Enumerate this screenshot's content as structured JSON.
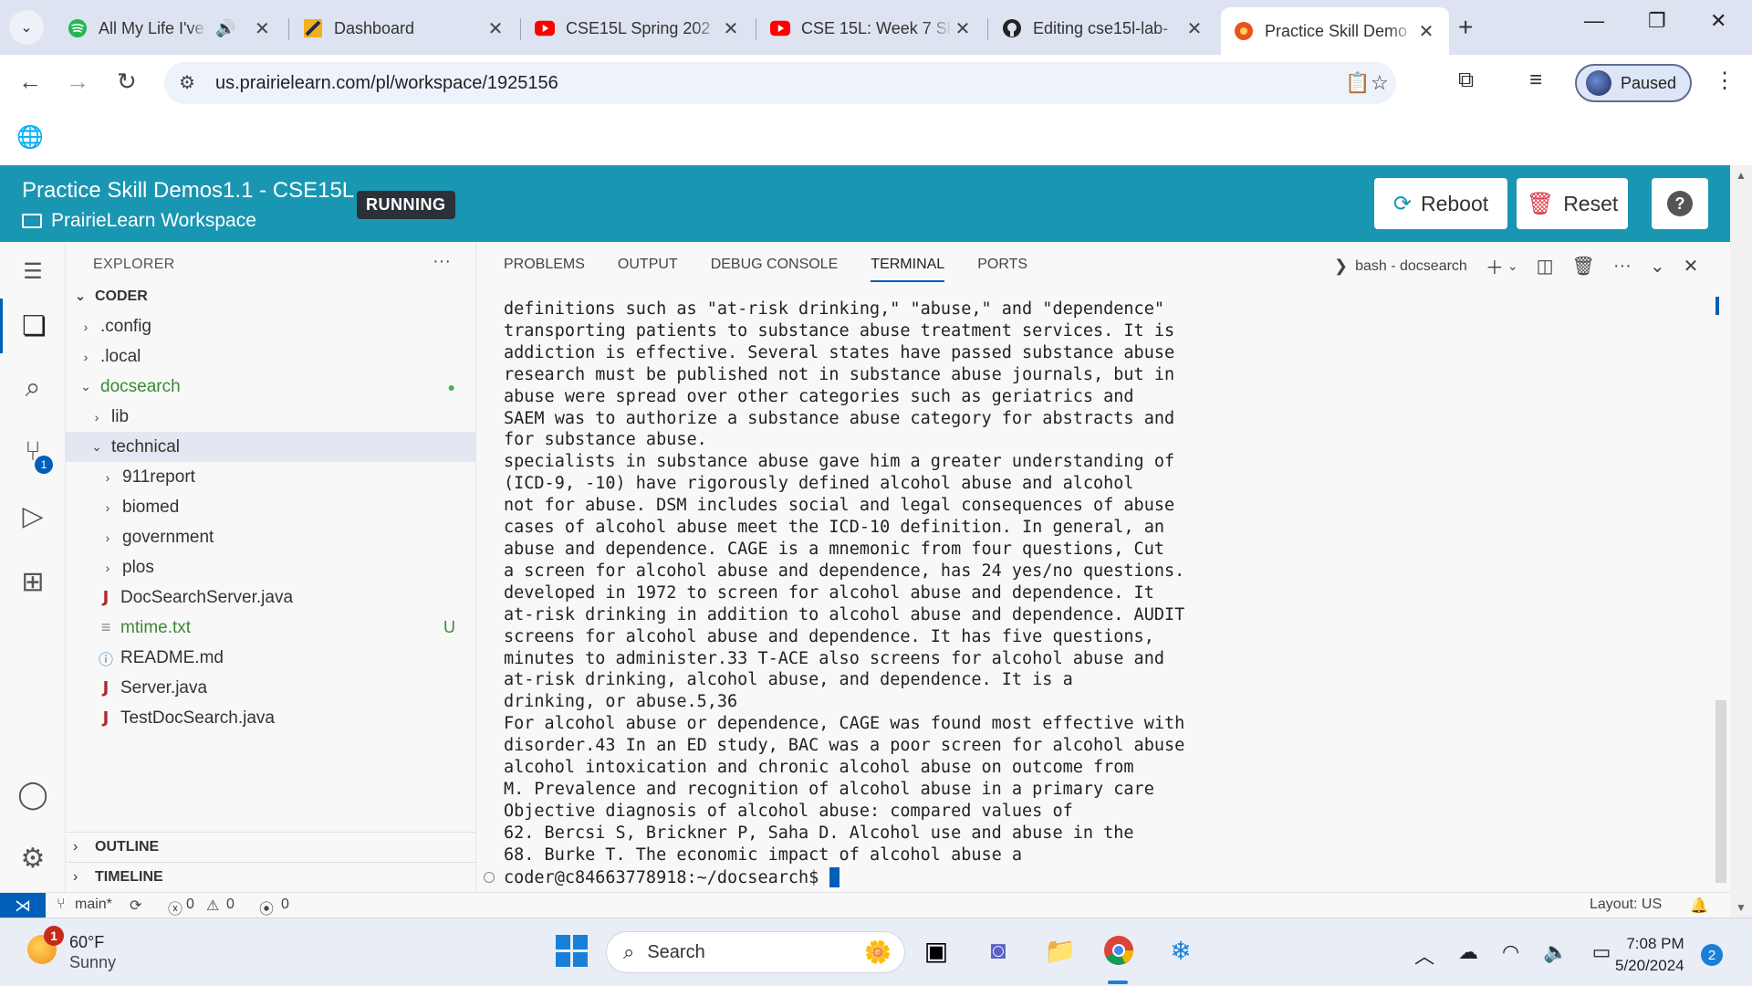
{
  "browser": {
    "tabs": [
      {
        "title": "All My Life I've",
        "icon": "spotify-icon",
        "audio": true
      },
      {
        "title": "Dashboard",
        "icon": "canvas-icon"
      },
      {
        "title": "CSE15L Spring 202",
        "icon": "youtube-icon"
      },
      {
        "title": "CSE 15L: Week 7 Sl",
        "icon": "youtube-icon"
      },
      {
        "title": "Editing cse15l-lab-",
        "icon": "github-icon"
      },
      {
        "title": "Practice Skill Demo",
        "icon": "prairielearn-icon",
        "active": true
      }
    ],
    "url": "us.prairielearn.com/pl/workspace/1925156",
    "profile_label": "Paused"
  },
  "workspace": {
    "title": "Practice Skill Demos1.1 - CSE15L",
    "subtitle": "PrairieLearn Workspace",
    "status": "RUNNING",
    "reboot_label": "Reboot",
    "reset_label": "Reset",
    "help_label": "?"
  },
  "explorer": {
    "header": "EXPLORER",
    "more": "···",
    "root": "CODER",
    "items": [
      {
        "label": ".config",
        "kind": "folder",
        "depth": 1,
        "open": false
      },
      {
        "label": ".local",
        "kind": "folder",
        "depth": 1,
        "open": false
      },
      {
        "label": "docsearch",
        "kind": "folder",
        "depth": 1,
        "open": true,
        "modified_dot": true
      },
      {
        "label": "lib",
        "kind": "folder",
        "depth": 2,
        "open": false
      },
      {
        "label": "technical",
        "kind": "folder",
        "depth": 2,
        "open": true,
        "selected": true
      },
      {
        "label": "911report",
        "kind": "folder",
        "depth": 3,
        "open": false
      },
      {
        "label": "biomed",
        "kind": "folder",
        "depth": 3,
        "open": false
      },
      {
        "label": "government",
        "kind": "folder",
        "depth": 3,
        "open": false
      },
      {
        "label": "plos",
        "kind": "folder",
        "depth": 3,
        "open": false
      },
      {
        "label": "DocSearchServer.java",
        "kind": "java",
        "depth": 2
      },
      {
        "label": "mtime.txt",
        "kind": "txt",
        "depth": 2,
        "status": "U"
      },
      {
        "label": "README.md",
        "kind": "info",
        "depth": 2
      },
      {
        "label": "Server.java",
        "kind": "java",
        "depth": 2
      },
      {
        "label": "TestDocSearch.java",
        "kind": "java",
        "depth": 2
      }
    ],
    "outline_label": "OUTLINE",
    "timeline_label": "TIMELINE"
  },
  "panel": {
    "tabs": [
      "PROBLEMS",
      "OUTPUT",
      "DEBUG CONSOLE",
      "TERMINAL",
      "PORTS"
    ],
    "active_tab": "TERMINAL",
    "terminal_name": "bash - docsearch",
    "terminal_lines": [
      "definitions such as \"at-risk drinking,\" \"abuse,\" and \"dependence\"",
      "transporting patients to substance abuse treatment services. It is",
      "addiction is effective. Several states have passed substance abuse",
      "research must be published not in substance abuse journals, but in",
      "abuse were spread over other categories such as geriatrics and",
      "SAEM was to authorize a substance abuse category for abstracts and",
      "for substance abuse.",
      "specialists in substance abuse gave him a greater understanding of",
      "(ICD-9, -10) have rigorously defined alcohol abuse and alcohol",
      "not for abuse. DSM includes social and legal consequences of abuse",
      "cases of alcohol abuse meet the ICD-10 definition. In general, an",
      "abuse and dependence. CAGE is a mnemonic from four questions, Cut",
      "a screen for alcohol abuse and dependence, has 24 yes/no questions.",
      "developed in 1972 to screen for alcohol abuse and dependence. It",
      "at-risk drinking in addition to alcohol abuse and dependence. AUDIT",
      "screens for alcohol abuse and dependence. It has five questions,",
      "minutes to administer.33 T-ACE also screens for alcohol abuse and",
      "at-risk drinking, alcohol abuse, and dependence. It is a",
      "drinking, or abuse.5,36",
      "For alcohol abuse or dependence, CAGE was found most effective with",
      "disorder.43 In an ED study, BAC was a poor screen for alcohol abuse",
      "alcohol intoxication and chronic alcohol abuse on outcome from",
      "M. Prevalence and recognition of alcohol abuse in a primary care",
      "Objective diagnosis of alcohol abuse: compared values of",
      "62. Bercsi S, Brickner P, Saha D. Alcohol use and abuse in the",
      "68. Burke T. The economic impact of alcohol abuse a"
    ],
    "prompt": "coder@c84663778918:~/docsearch$"
  },
  "activity": {
    "source_control_badge": "1"
  },
  "statusbar": {
    "branch": "main*",
    "errors": "0",
    "warnings": "0",
    "ports": "0",
    "layout": "Layout: US"
  },
  "taskbar": {
    "temp": "60°F",
    "condition": "Sunny",
    "weather_badge": "1",
    "search_placeholder": "Search",
    "time": "7:08 PM",
    "date": "5/20/2024",
    "notifications": "2"
  },
  "colors": {
    "accent": "#1996b2",
    "vscode_blue": "#005fb8",
    "danger": "#dc3545",
    "running_badge": "#2b3138"
  }
}
